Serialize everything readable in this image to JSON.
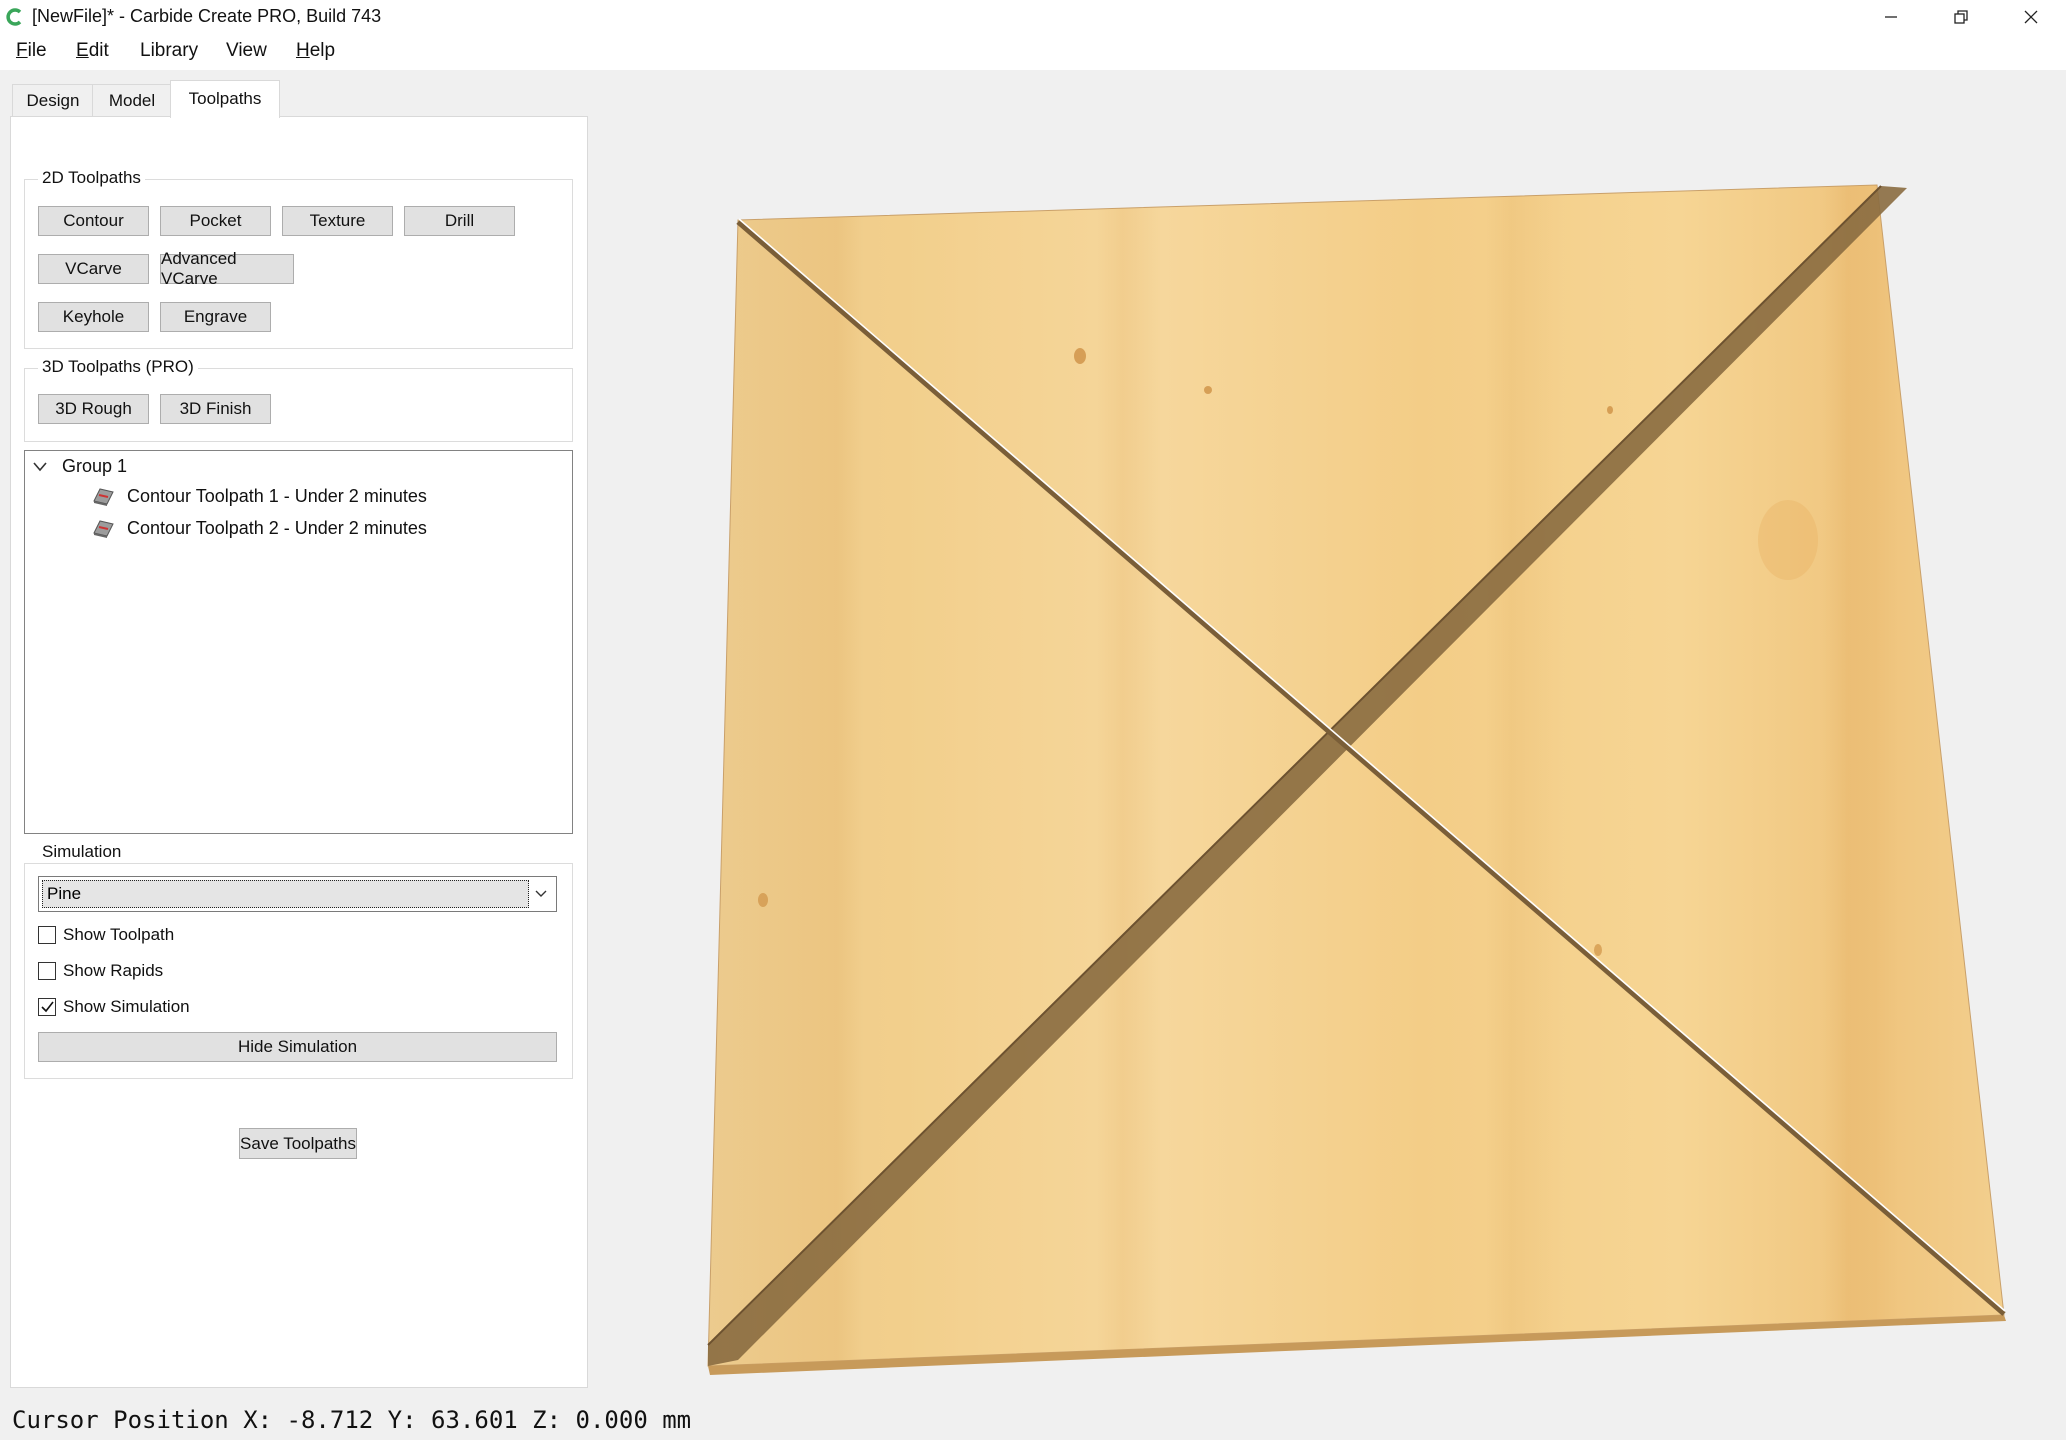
{
  "window": {
    "title": "[NewFile]* - Carbide Create PRO, Build 743",
    "minimize_icon": "minimize-icon",
    "restore_icon": "restore-icon",
    "close_icon": "close-icon"
  },
  "menubar": {
    "items": [
      {
        "label": "File",
        "mnemonic": "F",
        "rest": "ile"
      },
      {
        "label": "Edit",
        "mnemonic": "E",
        "rest": "dit"
      },
      {
        "label": "Library",
        "mnemonic": "",
        "rest": "Library"
      },
      {
        "label": "View",
        "mnemonic": "",
        "rest": "View"
      },
      {
        "label": "Help",
        "mnemonic": "H",
        "rest": "elp"
      }
    ]
  },
  "tabs": [
    {
      "label": "Design",
      "active": false
    },
    {
      "label": "Model",
      "active": false
    },
    {
      "label": "Toolpaths",
      "active": true
    }
  ],
  "toolpaths_2d": {
    "title": "2D Toolpaths",
    "buttons": [
      "Contour",
      "Pocket",
      "Texture",
      "Drill",
      "VCarve",
      "Advanced VCarve",
      "Keyhole",
      "Engrave"
    ]
  },
  "toolpaths_3d": {
    "title": "3D Toolpaths (PRO)",
    "buttons": [
      "3D Rough",
      "3D Finish"
    ]
  },
  "tree": {
    "group_label": "Group 1",
    "items": [
      {
        "label": "Contour Toolpath 1 - Under 2 minutes"
      },
      {
        "label": "Contour Toolpath 2 - Under 2 minutes"
      }
    ]
  },
  "simulation": {
    "title": "Simulation",
    "material": "Pine",
    "checkboxes": [
      {
        "label": "Show Toolpath",
        "checked": false
      },
      {
        "label": "Show Rapids",
        "checked": false
      },
      {
        "label": "Show Simulation",
        "checked": true
      }
    ],
    "hide_button": "Hide Simulation"
  },
  "save_button": "Save Toolpaths",
  "status": {
    "cursor_position": "Cursor Position X: -8.712 Y: 63.601 Z: 0.000 mm"
  },
  "colors": {
    "wood_light": "#f3cf8e",
    "wood_dark": "#e0ad62",
    "groove": "#8a6b40",
    "app_icon": "#3aa65a"
  }
}
